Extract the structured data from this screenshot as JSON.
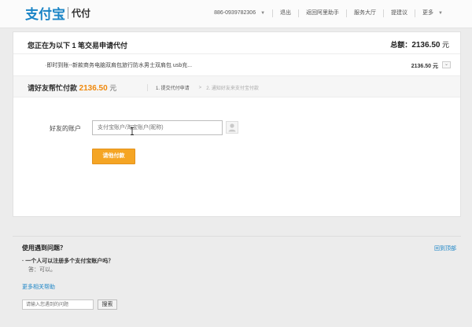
{
  "header": {
    "logo": "支付宝",
    "logo_sub": "代付",
    "nav": [
      {
        "label": "886-0939782306",
        "has_menu": true
      },
      {
        "label": "退出",
        "has_menu": false
      },
      {
        "label": "返回阿里助手",
        "has_menu": false
      },
      {
        "label": "服务大厅",
        "has_menu": false
      },
      {
        "label": "提建议",
        "has_menu": false
      },
      {
        "label": "更多",
        "has_menu": true
      }
    ],
    "caret": "▼"
  },
  "order": {
    "title": "您正在为以下 1 笔交易申请代付",
    "total_label": "总额：",
    "total_amount": "2136.50",
    "total_unit": "元",
    "item_name": "·即时到账--新款商务电脑双肩包旅行防水男士双肩包 usb充...",
    "item_amount": "2136.50 元",
    "toggle": "⌄"
  },
  "request": {
    "label": "请好友帮忙付款",
    "amount": "2136.50",
    "unit": "元",
    "step1": "1. 提交代付申请",
    "arrow": ">",
    "step2": "2. 通知好友来支付宝付款"
  },
  "form": {
    "account_label": "好友的账户",
    "account_placeholder": "支付宝账户/淘宝账户(昵称)",
    "submit_label": "请他付款"
  },
  "help": {
    "title": "使用遇到问题？",
    "back_to_top": "回到顶部",
    "question": "· 一个人可以注册多个支付宝账户吗？",
    "answer": "答：可以。",
    "more_link": "更多相关帮助",
    "search_placeholder": "请输入您遇到的问题",
    "search_label": "搜索"
  },
  "colors": {
    "brand": "#1a84c6",
    "accent": "#f5a524",
    "amount": "#f0890c"
  }
}
